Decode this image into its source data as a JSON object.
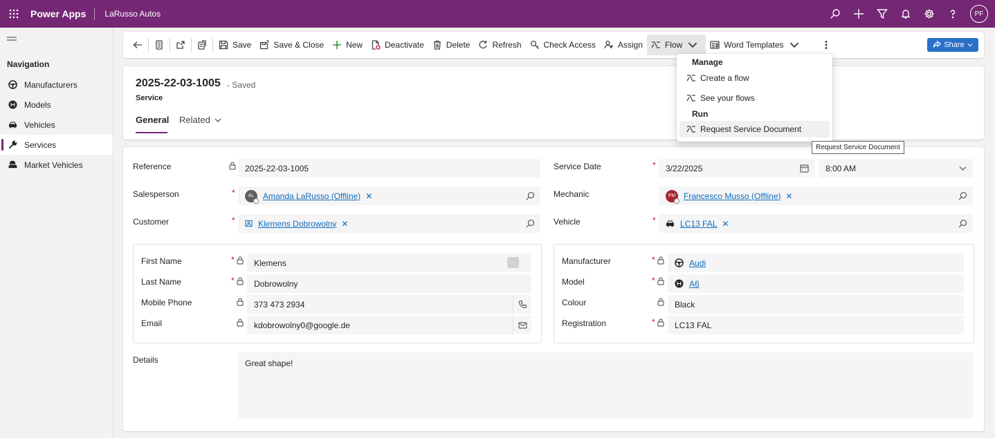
{
  "topbar": {
    "app_name": "Power Apps",
    "environment": "LaRusso Autos",
    "user_initials": "PF",
    "icons": [
      "search-icon",
      "plus-icon",
      "filter-icon",
      "bell-icon",
      "gear-icon",
      "help-icon"
    ]
  },
  "sidebar": {
    "header": "Navigation",
    "items": [
      {
        "label": "Manufacturers",
        "icon": "steering-wheel-icon"
      },
      {
        "label": "Models",
        "icon": "gearshift-icon"
      },
      {
        "label": "Vehicles",
        "icon": "car-icon"
      },
      {
        "label": "Services",
        "icon": "wrench-icon",
        "active": true
      },
      {
        "label": "Market Vehicles",
        "icon": "car-group-icon"
      }
    ]
  },
  "commands": {
    "save": "Save",
    "save_close": "Save & Close",
    "new": "New",
    "deactivate": "Deactivate",
    "delete": "Delete",
    "refresh": "Refresh",
    "check_access": "Check Access",
    "assign": "Assign",
    "flow": "Flow",
    "word_templates": "Word Templates",
    "share": "Share"
  },
  "record": {
    "title": "2025-22-03-1005",
    "status": "- Saved",
    "entity": "Service",
    "tabs": {
      "general": "General",
      "related": "Related"
    }
  },
  "form": {
    "reference": {
      "label": "Reference",
      "value": "2025-22-03-1005"
    },
    "salesperson": {
      "label": "Salesperson",
      "value": "Amanda LaRusso (Offline)",
      "initials": "AL"
    },
    "customer": {
      "label": "Customer",
      "value": "Klemens Dobrowolny"
    },
    "service_date": {
      "label": "Service Date",
      "date": "3/22/2025",
      "time": "8:00 AM"
    },
    "mechanic": {
      "label": "Mechanic",
      "value": "Francesco Musso (Offline)",
      "initials": "FM"
    },
    "vehicle": {
      "label": "Vehicle",
      "value": "LC13 FAL"
    },
    "first_name": {
      "label": "First Name",
      "value": "Klemens"
    },
    "last_name": {
      "label": "Last Name",
      "value": "Dobrowolny"
    },
    "mobile_phone": {
      "label": "Mobile Phone",
      "value": "373 473 2934"
    },
    "email": {
      "label": "Email",
      "value": "kdobrowolny0@google.de"
    },
    "manufacturer": {
      "label": "Manufacturer",
      "value": "Audi"
    },
    "model": {
      "label": "Model",
      "value": "A6"
    },
    "colour": {
      "label": "Colour",
      "value": "Black"
    },
    "registration": {
      "label": "Registration",
      "value": "LC13 FAL"
    },
    "details": {
      "label": "Details",
      "value": "Great shape!"
    }
  },
  "flow_menu": {
    "manage_header": "Manage",
    "create_flow": "Create a flow",
    "see_flows": "See your flows",
    "run_header": "Run",
    "request_doc": "Request Service Document"
  },
  "tooltip": "Request Service Document",
  "colors": {
    "brand": "#742774",
    "link": "#0f6cbd",
    "required": "#c50f1f",
    "share": "#2b6fc8"
  }
}
